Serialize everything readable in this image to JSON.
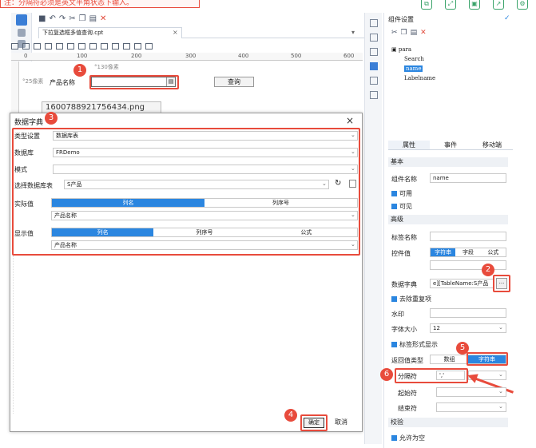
{
  "note": "注：分隔符必须是英文半角状态下输入。",
  "top_icons": [
    "copy-icon",
    "expand-icon",
    "save-icon",
    "export-icon",
    "gear-icon"
  ],
  "toolbar_icons": [
    "save-icon",
    "undo-icon",
    "redo-icon",
    "cut-icon",
    "copy-icon",
    "paste-icon",
    "delete-icon"
  ],
  "tab": {
    "label": "下拉复选框多值查询.cpt",
    "close": "×",
    "menu": "▾"
  },
  "ruler_ticks": [
    "0",
    "100",
    "200",
    "300",
    "400",
    "500",
    "600"
  ],
  "design": {
    "row_label_a": "°130像素",
    "row_label_b": "°25像素",
    "product_label": "产品名称",
    "query_button": "查询"
  },
  "file_popup": "1600788921756434.png",
  "badges": [
    "1",
    "2",
    "3",
    "4",
    "5",
    "6"
  ],
  "dialog": {
    "title": "数据字典",
    "close": "×",
    "type_label": "类型设置",
    "type_value": "数据库表",
    "db_label": "数据库",
    "db_value": "FRDemo",
    "mode_label": "模式",
    "mode_value": "",
    "table_label": "选择数据库表",
    "table_value": "S产品",
    "actual_label": "实际值",
    "actual_seg": [
      "列名",
      "列序号"
    ],
    "actual_value": "产品名称",
    "display_label": "显示值",
    "display_seg": [
      "列名",
      "列序号",
      "公式"
    ],
    "display_value": "产品名称",
    "ok": "确定",
    "cancel": "取消"
  },
  "panel": {
    "title": "组件设置",
    "check": "✓",
    "tree": {
      "root": "para",
      "items": [
        "Search",
        "name",
        "Labelname"
      ],
      "selected": "name"
    },
    "tabs": [
      "属性",
      "事件",
      "移动端"
    ],
    "sec_basic": "基本",
    "widget_name_label": "组件名称",
    "widget_name_value": "name",
    "enabled": "可用",
    "visible": "可见",
    "sec_advanced": "高级",
    "tag_name_label": "标签名称",
    "control_value_label": "控件值",
    "control_seg": [
      "字符串",
      "字段",
      "公式"
    ],
    "data_dict_label": "数据字典",
    "data_dict_value": "e][TableName:S产品",
    "data_dict_btn": "···",
    "dedupe": "去除重复项",
    "watermark_label": "水印",
    "font_size_label": "字体大小",
    "font_size_value": "12",
    "tag_display": "标签形式显示",
    "return_type_label": "返回值类型",
    "return_seg": [
      "数组",
      "字符串"
    ],
    "separator_label": "分隔符",
    "separator_value": "','",
    "start_label": "起始符",
    "end_label": "结束符",
    "sec_validate": "校验",
    "allow_empty": "允许为空"
  }
}
